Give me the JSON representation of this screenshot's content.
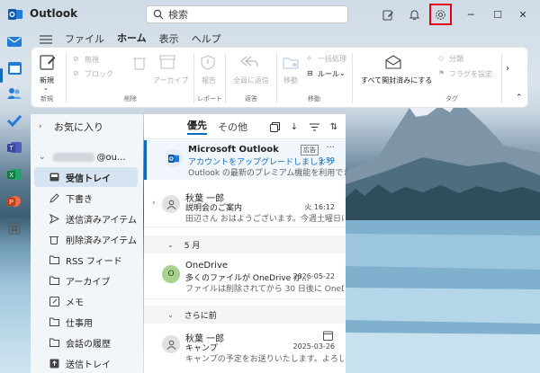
{
  "app": {
    "title": "Outlook"
  },
  "search": {
    "placeholder": "検索"
  },
  "ribbon": {
    "tabs": [
      {
        "label": "ファイル"
      },
      {
        "label": "ホーム"
      },
      {
        "label": "表示"
      },
      {
        "label": "ヘルプ"
      }
    ],
    "new_label": "新規",
    "new_group": "新規",
    "ignore_label": "無視",
    "block_label": "ブロック",
    "delete_group": "削除",
    "archive_label": "アーカイブ",
    "report_label": "報告",
    "report_group": "レポート",
    "reply_all_label": "全員に返信",
    "respond_group": "返答",
    "move_label": "移動",
    "bulk_label": "一括処理",
    "rules_label": "ルール",
    "move_group": "移動",
    "mark_all_read_label": "すべて開封済みにする",
    "categorize_label": "分類",
    "flag_label": "フラグを設定",
    "tags_group": "タグ"
  },
  "folders": {
    "favorites_label": "お気に入り",
    "account_suffix": "@ou...",
    "items": [
      {
        "label": "受信トレイ",
        "active": true
      },
      {
        "label": "下書き"
      },
      {
        "label": "送信済みアイテム"
      },
      {
        "label": "削除済みアイテム"
      },
      {
        "label": "RSS フィード"
      },
      {
        "label": "アーカイブ"
      },
      {
        "label": "メモ"
      },
      {
        "label": "仕事用"
      },
      {
        "label": "会話の履歴"
      },
      {
        "label": "送信トレイ"
      }
    ]
  },
  "message_list": {
    "tab_focused": "優先",
    "tab_other": "その他",
    "messages": [
      {
        "sender": "Microsoft Outlook",
        "subject": "アカウントをアップグレードしましょう",
        "preview": "Outlook の最新のプレミアム機能を利用でき...",
        "time": "9:59",
        "badge": "広告",
        "avatar": "outlook"
      },
      {
        "sender": "秋葉 一郎",
        "subject": "説明会のご案内",
        "preview": "田辺さん おはようございます。今週土曜日に...",
        "time": "火 16:12"
      },
      {
        "sender": "OneDrive",
        "subject": "多くのファイルが OneDrive か...",
        "preview": "ファイルは削除されてから 30 日後に OneDri...",
        "time": "2026-05-22",
        "avatar_letter": "O"
      },
      {
        "sender": "秋葉 一郎",
        "subject": "キャンプ",
        "preview": "キャンプの予定をお送りいたします。よろしく...",
        "time": "2025-03-26"
      }
    ],
    "section_may": "5 月",
    "section_earlier": "さらに前"
  },
  "colors": {
    "accent": "#0f6cbd",
    "highlight_box": "#e0001a"
  }
}
